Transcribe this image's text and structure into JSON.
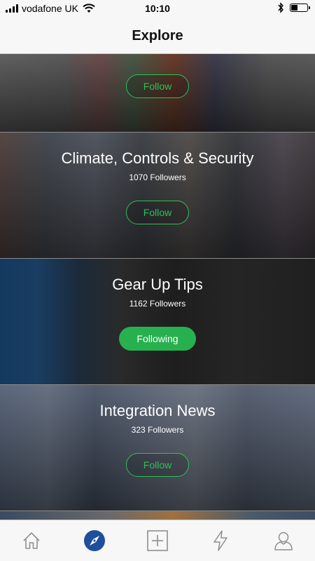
{
  "status_bar": {
    "carrier": "vodafone UK",
    "time": "10:10",
    "battery_level": 0.45
  },
  "nav": {
    "title": "Explore"
  },
  "cards": [
    {
      "title": "",
      "followers": "",
      "button": "Follow",
      "following": false
    },
    {
      "title": "Climate, Controls & Security",
      "followers": "1070 Followers",
      "button": "Follow",
      "following": false
    },
    {
      "title": "Gear Up Tips",
      "followers": "1162 Followers",
      "button": "Following",
      "following": true
    },
    {
      "title": "Integration News",
      "followers": "323 Followers",
      "button": "Follow",
      "following": false
    }
  ],
  "tabs": [
    {
      "name": "home",
      "icon": "home-icon",
      "active": false
    },
    {
      "name": "explore",
      "icon": "compass-icon",
      "active": true
    },
    {
      "name": "add",
      "icon": "plus-square-icon",
      "active": false
    },
    {
      "name": "activity",
      "icon": "lightning-icon",
      "active": false
    },
    {
      "name": "profile",
      "icon": "person-icon",
      "active": false
    }
  ],
  "colors": {
    "accent_green": "#27b14e",
    "active_tab_blue": "#1f4f9c",
    "inactive_icon": "#8e8e8e"
  }
}
